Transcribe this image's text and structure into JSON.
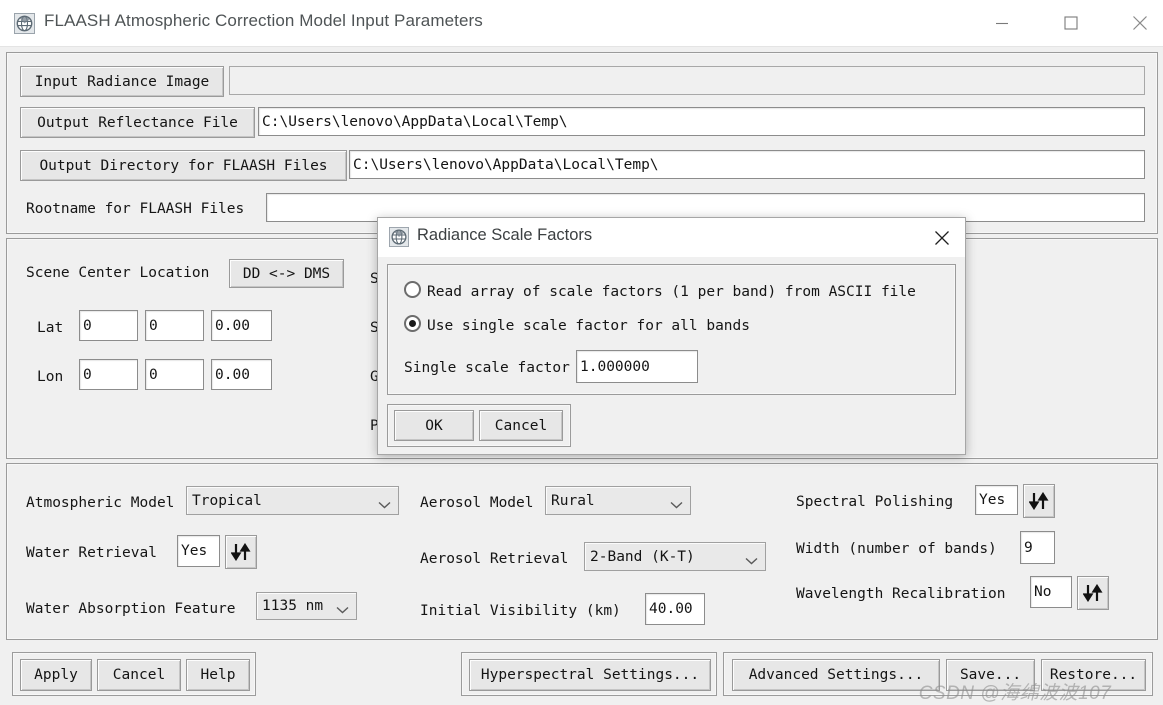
{
  "window": {
    "title": "FLAASH Atmospheric Correction Model Input Parameters",
    "icon": "envi-globe-icon",
    "minimize_label": "—",
    "maximize_label": "□",
    "close_label": "✕"
  },
  "files_panel": {
    "input_radiance": {
      "button": "Input Radiance Image",
      "value": ""
    },
    "output_reflectance": {
      "button": "Output Reflectance File",
      "value": "C:\\Users\\lenovo\\AppData\\Local\\Temp\\"
    },
    "output_directory": {
      "button": "Output Directory for FLAASH Files",
      "value": "C:\\Users\\lenovo\\AppData\\Local\\Temp\\"
    },
    "rootname": {
      "label": "Rootname for FLAASH Files",
      "value": ""
    }
  },
  "scene_panel": {
    "scene_center_label": "Scene Center Location",
    "dd_dms_button": "DD <-> DMS",
    "lat_label": "Lat",
    "lat_values": [
      "0",
      "0",
      "0.00"
    ],
    "lon_label": "Lon",
    "lon_values": [
      "0",
      "0",
      "0.00"
    ],
    "occluded_labels": [
      "Se",
      "Se",
      "Gr",
      "Pi"
    ]
  },
  "model_panel": {
    "atmospheric_model": {
      "label": "Atmospheric Model",
      "value": "Tropical"
    },
    "water_retrieval": {
      "label": "Water Retrieval",
      "value": "Yes",
      "toggle_icon": "updown-arrows-icon"
    },
    "water_absorption": {
      "label": "Water Absorption Feature",
      "value": "1135 nm"
    },
    "aerosol_model": {
      "label": "Aerosol Model",
      "value": "Rural"
    },
    "aerosol_retrieval": {
      "label": "Aerosol Retrieval",
      "value": "2-Band (K-T)"
    },
    "initial_visibility": {
      "label": "Initial Visibility (km)",
      "value": "40.00"
    },
    "spectral_polishing": {
      "label": "Spectral Polishing",
      "value": "Yes",
      "toggle_icon": "updown-arrows-icon"
    },
    "width_bands": {
      "label": "Width (number of bands)",
      "value": "9"
    },
    "wavelength_recalibration": {
      "label": "Wavelength Recalibration",
      "value": "No",
      "toggle_icon": "updown-arrows-icon"
    }
  },
  "bottom_bar": {
    "apply": "Apply",
    "cancel": "Cancel",
    "help": "Help",
    "hyperspectral_settings": "Hyperspectral Settings...",
    "advanced_settings": "Advanced Settings...",
    "save": "Save...",
    "restore": "Restore..."
  },
  "dialog": {
    "title": "Radiance Scale Factors",
    "icon": "envi-globe-icon",
    "close_label": "✕",
    "option_array": {
      "label": "Read array of scale factors (1 per band) from ASCII file",
      "selected": false
    },
    "option_single": {
      "label": "Use single scale factor for all bands",
      "selected": true
    },
    "single_factor": {
      "label": "Single scale factor",
      "value": "1.000000"
    },
    "ok": "OK",
    "cancel": "Cancel"
  },
  "watermark": {
    "text": "CSDN @海绵波波107"
  },
  "colors": {
    "window_bg": "#f0f0f0",
    "titlebar_bg": "#ffffff",
    "title_text": "#4f5456",
    "border": "#9b9b9b",
    "field_bg": "#ffffff",
    "button_bg": "#e7e7e7"
  }
}
